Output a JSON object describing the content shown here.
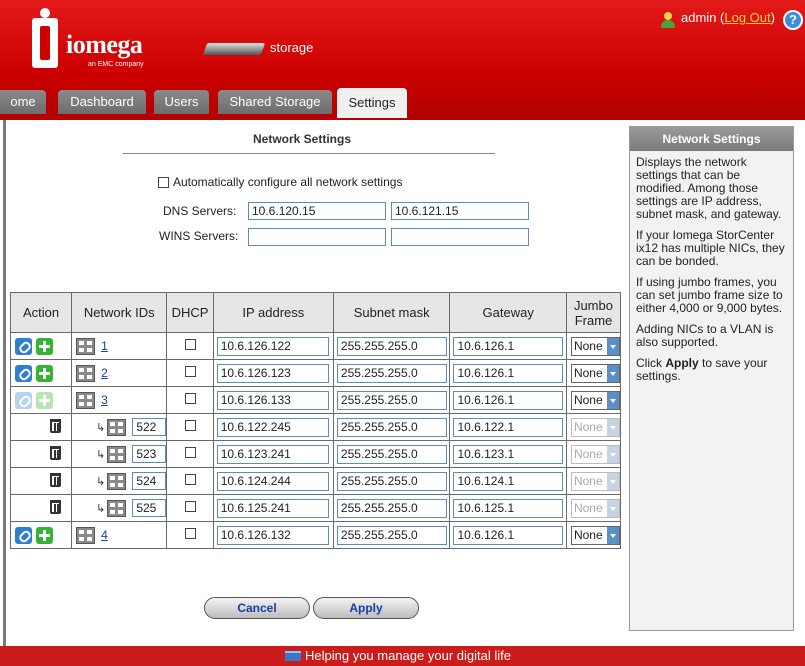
{
  "header": {
    "brand": "iomega",
    "brand_sub": "an EMC company",
    "device_label": "storage",
    "user": "admin",
    "logout_label": "Log Out",
    "help_label": "?"
  },
  "tabs": [
    {
      "label": "Home",
      "display": "ome"
    },
    {
      "label": "Dashboard"
    },
    {
      "label": "Users"
    },
    {
      "label": "Shared Storage"
    },
    {
      "label": "Settings",
      "active": true
    }
  ],
  "section": {
    "title": "Network Settings",
    "auto_config_label": "Automatically configure all network settings",
    "auto_config_checked": false,
    "dns_label": "DNS Servers:",
    "dns1": "10.6.120.15",
    "dns2": "10.6.121.15",
    "wins_label": "WINS Servers:",
    "wins1": "",
    "wins2": ""
  },
  "table": {
    "headers": {
      "action": "Action",
      "network_ids": "Network IDs",
      "dhcp": "DHCP",
      "ip": "IP address",
      "subnet": "Subnet mask",
      "gateway": "Gateway",
      "jumbo_line1": "Jumbo",
      "jumbo_line2": "Frame"
    },
    "rows": [
      {
        "id": "1",
        "ip": "10.6.126.122",
        "subnet": "255.255.255.0",
        "gateway": "10.6.126.1",
        "jumbo": "None"
      },
      {
        "id": "2",
        "ip": "10.6.126.123",
        "subnet": "255.255.255.0",
        "gateway": "10.6.126.1",
        "jumbo": "None"
      },
      {
        "id": "3",
        "ip": "10.6.126.133",
        "subnet": "255.255.255.0",
        "gateway": "10.6.126.1",
        "jumbo": "None"
      },
      {
        "id": "522",
        "ip": "10.6.122.245",
        "subnet": "255.255.255.0",
        "gateway": "10.6.122.1",
        "jumbo": "None"
      },
      {
        "id": "523",
        "ip": "10.6.123.241",
        "subnet": "255.255.255.0",
        "gateway": "10.6.123.1",
        "jumbo": "None"
      },
      {
        "id": "524",
        "ip": "10.6.124.244",
        "subnet": "255.255.255.0",
        "gateway": "10.6.124.1",
        "jumbo": "None"
      },
      {
        "id": "525",
        "ip": "10.6.125.241",
        "subnet": "255.255.255.0",
        "gateway": "10.6.125.1",
        "jumbo": "None"
      },
      {
        "id": "4",
        "ip": "10.6.126.132",
        "subnet": "255.255.255.0",
        "gateway": "10.6.126.1",
        "jumbo": "None"
      }
    ]
  },
  "buttons": {
    "cancel": "Cancel",
    "apply": "Apply"
  },
  "help": {
    "title": "Network Settings",
    "p1": "Displays the network settings that can be modified. Among those settings are IP address, subnet mask, and gateway.",
    "p2": "If your Iomega StorCenter ix12 has multiple NICs, they can be bonded.",
    "p3": "If using jumbo frames, you can set jumbo frame size to either 4,000 or 9,000 bytes.",
    "p4": "Adding NICs to a VLAN is also supported.",
    "p5_pre": "Click ",
    "p5_bold": "Apply",
    "p5_post": " to save your settings."
  },
  "footer": {
    "tagline": "Helping you manage your digital life"
  }
}
